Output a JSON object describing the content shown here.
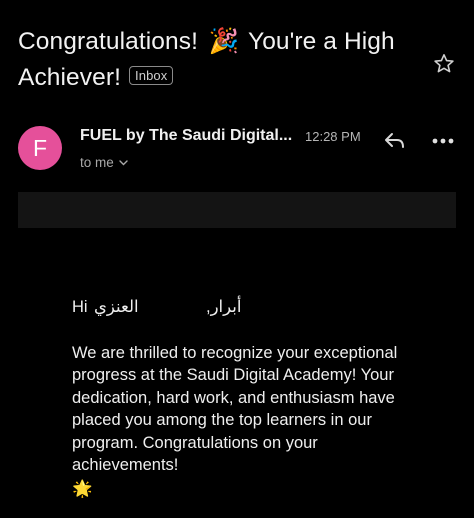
{
  "email": {
    "subject_part1": "Congratulations! ",
    "subject_emoji": "🎉",
    "subject_part2": " You're a High Achiever!",
    "label": "Inbox"
  },
  "icons": {
    "star": "star-icon",
    "reply": "reply-icon",
    "more": "more-horizontal-icon",
    "chevron": "chevron-down-icon"
  },
  "sender": {
    "avatar_letter": "F",
    "avatar_color": "#e5509a",
    "name": "FUEL by The Saudi Digital...",
    "time": "12:28 PM",
    "recipient": "to me"
  },
  "message": {
    "greeting_hi": "Hi",
    "greeting_family_name": "العنزي",
    "greeting_given_name": "أبرار,",
    "paragraph": "We are thrilled to recognize your exceptional progress at the Saudi Digital Academy! Your dedication, hard work, and enthusiasm have placed you among the top learners in our program. Congratulations on your achievements!",
    "closing_emoji": "🌟"
  }
}
